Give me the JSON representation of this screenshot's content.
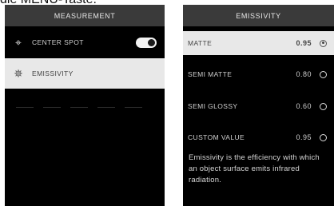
{
  "caption": "die MENU-Taste.",
  "measurement_screen": {
    "title": "MEASUREMENT",
    "items": [
      {
        "label": "CENTER SPOT",
        "icon": "crosshair-icon",
        "toggle_on": true
      },
      {
        "label": "EMISSIVITY",
        "icon": "emissivity-sun-icon",
        "selected": true
      }
    ]
  },
  "emissivity_screen": {
    "title": "EMISSIVITY",
    "options": [
      {
        "label": "MATTE",
        "value": "0.95",
        "selected": true
      },
      {
        "label": "SEMI MATTE",
        "value": "0.80",
        "selected": false
      },
      {
        "label": "SEMI GLOSSY",
        "value": "0.60",
        "selected": false
      },
      {
        "label": "CUSTOM VALUE",
        "value": "0.95",
        "selected": false
      }
    ],
    "description": "Emissivity is the efficiency with which an object surface emits infrared radiation."
  },
  "colors": {
    "screen_bg": "#000000",
    "header_bg": "#3a3a3a",
    "selected_row_bg": "#e8e8e8"
  }
}
